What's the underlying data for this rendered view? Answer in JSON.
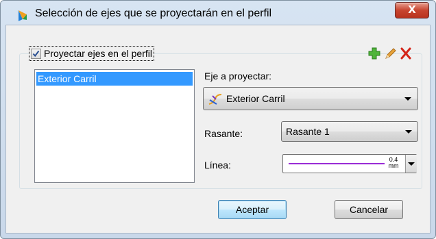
{
  "window": {
    "title": "Selección de ejes que se proyectarán en el perfil",
    "close_label": "X"
  },
  "group": {
    "checkbox_label": "Proyectar ejes en el perfil",
    "checked": true,
    "icons": [
      "add-icon",
      "edit-pencil-icon",
      "delete-x-icon"
    ]
  },
  "axes_list": {
    "items": [
      "Exterior Carril"
    ],
    "selected_index": 0
  },
  "form": {
    "eje_label": "Eje a proyectar:",
    "eje_value": "Exterior Carril",
    "rasante_label": "Rasante:",
    "rasante_value": "Rasante 1",
    "linea_label": "Línea:",
    "linea_width_value": "0.4",
    "linea_width_unit": "mm",
    "linea_color": "#9a2cd6"
  },
  "buttons": {
    "accept_label": "Aceptar",
    "cancel_label": "Cancelar"
  }
}
